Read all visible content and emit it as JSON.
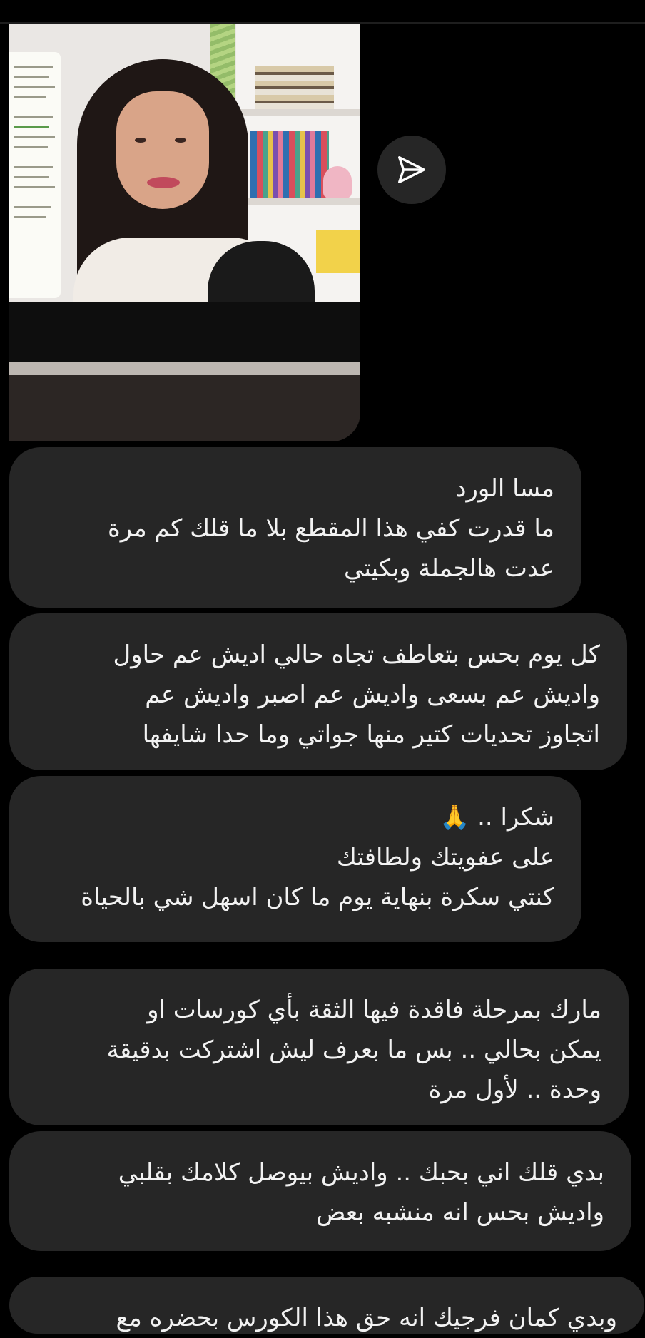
{
  "video": {
    "label": "shared video clip"
  },
  "send": {
    "icon": "send-icon"
  },
  "messages": [
    {
      "lines": [
        "مسا الورد",
        "ما قدرت كفي هذا المقطع بلا ما قلك كم مرة",
        "عدت هالجملة وبكيتي"
      ]
    },
    {
      "lines": [
        "كل يوم بحس بتعاطف تجاه حالي اديش عم حاول",
        "واديش عم بسعى واديش عم اصبر واديش عم",
        "اتجاوز تحديات كتير منها جواتي وما  حدا شايفها"
      ]
    },
    {
      "lines": [
        "شكرا .. 🙏",
        "على عفويتك ولطافتك",
        "كنتي سكرة بنهاية يوم ما كان اسهل شي بالحياة"
      ]
    },
    {
      "lines": [
        "مارك بمرحلة فاقدة فيها الثقة بأي كورسات او",
        "يمكن بحالي .. بس ما بعرف ليش اشتركت بدقيقة",
        "وحدة .. لأول مرة"
      ]
    },
    {
      "lines": [
        "بدي قلك اني بحبك .. واديش بيوصل كلامك بقلبي",
        "واديش بحس انه منشبه بعض"
      ]
    },
    {
      "lines": [
        "وبدي كمان فرجيك انه حق هذا الكورس بحضره مع"
      ]
    }
  ]
}
